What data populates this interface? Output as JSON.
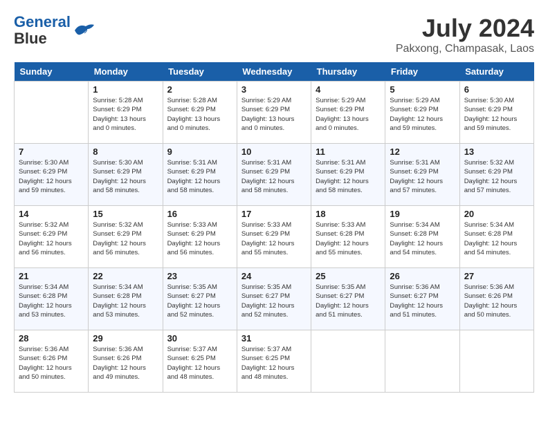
{
  "header": {
    "logo_line1": "General",
    "logo_line2": "Blue",
    "month": "July 2024",
    "location": "Pakxong, Champasak, Laos"
  },
  "days_of_week": [
    "Sunday",
    "Monday",
    "Tuesday",
    "Wednesday",
    "Thursday",
    "Friday",
    "Saturday"
  ],
  "weeks": [
    [
      {
        "day": "",
        "info": ""
      },
      {
        "day": "1",
        "info": "Sunrise: 5:28 AM\nSunset: 6:29 PM\nDaylight: 13 hours\nand 0 minutes."
      },
      {
        "day": "2",
        "info": "Sunrise: 5:28 AM\nSunset: 6:29 PM\nDaylight: 13 hours\nand 0 minutes."
      },
      {
        "day": "3",
        "info": "Sunrise: 5:29 AM\nSunset: 6:29 PM\nDaylight: 13 hours\nand 0 minutes."
      },
      {
        "day": "4",
        "info": "Sunrise: 5:29 AM\nSunset: 6:29 PM\nDaylight: 13 hours\nand 0 minutes."
      },
      {
        "day": "5",
        "info": "Sunrise: 5:29 AM\nSunset: 6:29 PM\nDaylight: 12 hours\nand 59 minutes."
      },
      {
        "day": "6",
        "info": "Sunrise: 5:30 AM\nSunset: 6:29 PM\nDaylight: 12 hours\nand 59 minutes."
      }
    ],
    [
      {
        "day": "7",
        "info": "Sunrise: 5:30 AM\nSunset: 6:29 PM\nDaylight: 12 hours\nand 59 minutes."
      },
      {
        "day": "8",
        "info": "Sunrise: 5:30 AM\nSunset: 6:29 PM\nDaylight: 12 hours\nand 58 minutes."
      },
      {
        "day": "9",
        "info": "Sunrise: 5:31 AM\nSunset: 6:29 PM\nDaylight: 12 hours\nand 58 minutes."
      },
      {
        "day": "10",
        "info": "Sunrise: 5:31 AM\nSunset: 6:29 PM\nDaylight: 12 hours\nand 58 minutes."
      },
      {
        "day": "11",
        "info": "Sunrise: 5:31 AM\nSunset: 6:29 PM\nDaylight: 12 hours\nand 58 minutes."
      },
      {
        "day": "12",
        "info": "Sunrise: 5:31 AM\nSunset: 6:29 PM\nDaylight: 12 hours\nand 57 minutes."
      },
      {
        "day": "13",
        "info": "Sunrise: 5:32 AM\nSunset: 6:29 PM\nDaylight: 12 hours\nand 57 minutes."
      }
    ],
    [
      {
        "day": "14",
        "info": "Sunrise: 5:32 AM\nSunset: 6:29 PM\nDaylight: 12 hours\nand 56 minutes."
      },
      {
        "day": "15",
        "info": "Sunrise: 5:32 AM\nSunset: 6:29 PM\nDaylight: 12 hours\nand 56 minutes."
      },
      {
        "day": "16",
        "info": "Sunrise: 5:33 AM\nSunset: 6:29 PM\nDaylight: 12 hours\nand 56 minutes."
      },
      {
        "day": "17",
        "info": "Sunrise: 5:33 AM\nSunset: 6:29 PM\nDaylight: 12 hours\nand 55 minutes."
      },
      {
        "day": "18",
        "info": "Sunrise: 5:33 AM\nSunset: 6:28 PM\nDaylight: 12 hours\nand 55 minutes."
      },
      {
        "day": "19",
        "info": "Sunrise: 5:34 AM\nSunset: 6:28 PM\nDaylight: 12 hours\nand 54 minutes."
      },
      {
        "day": "20",
        "info": "Sunrise: 5:34 AM\nSunset: 6:28 PM\nDaylight: 12 hours\nand 54 minutes."
      }
    ],
    [
      {
        "day": "21",
        "info": "Sunrise: 5:34 AM\nSunset: 6:28 PM\nDaylight: 12 hours\nand 53 minutes."
      },
      {
        "day": "22",
        "info": "Sunrise: 5:34 AM\nSunset: 6:28 PM\nDaylight: 12 hours\nand 53 minutes."
      },
      {
        "day": "23",
        "info": "Sunrise: 5:35 AM\nSunset: 6:27 PM\nDaylight: 12 hours\nand 52 minutes."
      },
      {
        "day": "24",
        "info": "Sunrise: 5:35 AM\nSunset: 6:27 PM\nDaylight: 12 hours\nand 52 minutes."
      },
      {
        "day": "25",
        "info": "Sunrise: 5:35 AM\nSunset: 6:27 PM\nDaylight: 12 hours\nand 51 minutes."
      },
      {
        "day": "26",
        "info": "Sunrise: 5:36 AM\nSunset: 6:27 PM\nDaylight: 12 hours\nand 51 minutes."
      },
      {
        "day": "27",
        "info": "Sunrise: 5:36 AM\nSunset: 6:26 PM\nDaylight: 12 hours\nand 50 minutes."
      }
    ],
    [
      {
        "day": "28",
        "info": "Sunrise: 5:36 AM\nSunset: 6:26 PM\nDaylight: 12 hours\nand 50 minutes."
      },
      {
        "day": "29",
        "info": "Sunrise: 5:36 AM\nSunset: 6:26 PM\nDaylight: 12 hours\nand 49 minutes."
      },
      {
        "day": "30",
        "info": "Sunrise: 5:37 AM\nSunset: 6:25 PM\nDaylight: 12 hours\nand 48 minutes."
      },
      {
        "day": "31",
        "info": "Sunrise: 5:37 AM\nSunset: 6:25 PM\nDaylight: 12 hours\nand 48 minutes."
      },
      {
        "day": "",
        "info": ""
      },
      {
        "day": "",
        "info": ""
      },
      {
        "day": "",
        "info": ""
      }
    ]
  ]
}
